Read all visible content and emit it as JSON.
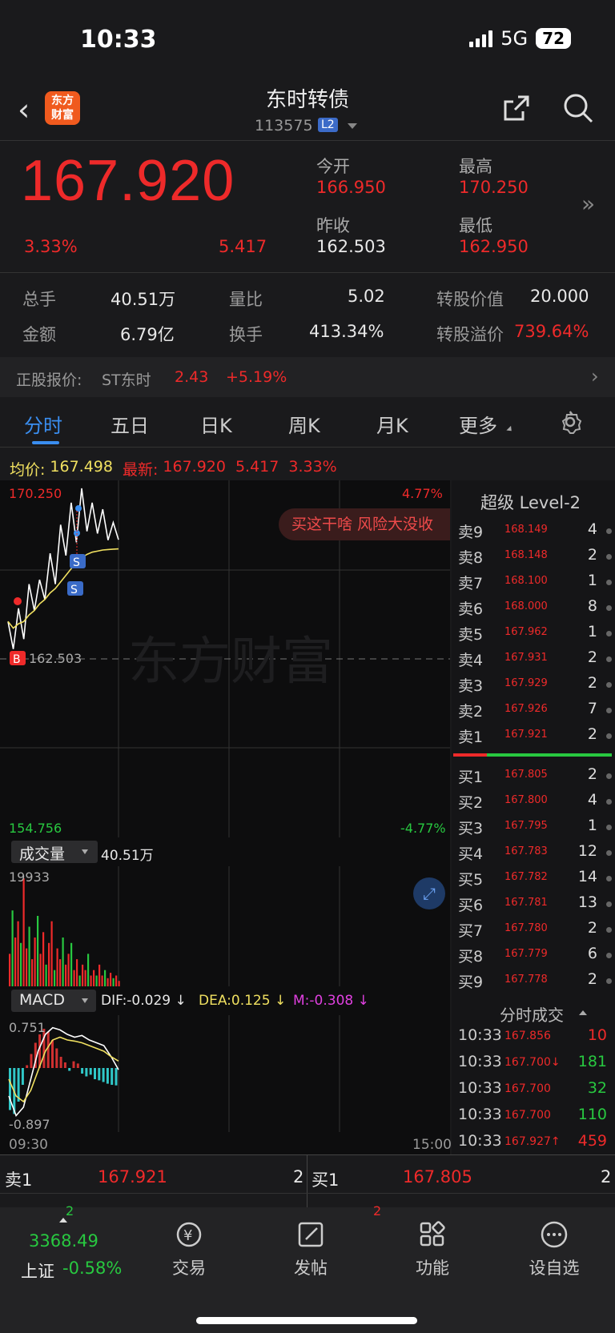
{
  "status_bar": {
    "time": "10:33",
    "network": "5G",
    "battery": "72"
  },
  "header": {
    "logo_text": "东方财富",
    "title": "东时转债",
    "code": "113575",
    "level_badge": "L2"
  },
  "quote": {
    "price": "167.920",
    "change_pct": "3.33%",
    "change": "5.417",
    "open_label": "今开",
    "open": "166.950",
    "prev_close_label": "昨收",
    "prev_close": "162.503",
    "high_label": "最高",
    "high": "170.250",
    "low_label": "最低",
    "low": "162.950"
  },
  "stats": {
    "volume_label": "总手",
    "volume": "40.51万",
    "amount_label": "金额",
    "amount": "6.79亿",
    "ratio_label": "量比",
    "ratio": "5.02",
    "turnover_label": "换手",
    "turnover": "413.34%",
    "conv_value_label": "转股价值",
    "conv_value": "20.000",
    "conv_premium_label": "转股溢价",
    "conv_premium": "739.64%"
  },
  "underlying": {
    "label": "正股报价:",
    "name": "ST东时",
    "price": "2.43",
    "change_pct": "+5.19%"
  },
  "tabs": [
    "分时",
    "五日",
    "日K",
    "周K",
    "月K",
    "更多"
  ],
  "chart_header": {
    "avg_label": "均价:",
    "avg": "167.498",
    "latest_label": "最新:",
    "latest": "167.920",
    "change": "5.417",
    "change_pct": "3.33%"
  },
  "chart": {
    "y_top": "170.250",
    "y_bottom": "154.756",
    "pct_top": "4.77%",
    "pct_bottom": "-4.77%",
    "mid_label": "162.503",
    "watermark": "东方财富",
    "banner": "买这干啥 风险大没收",
    "x_start": "09:30",
    "x_end": "15:00",
    "volume_label": "成交量",
    "volume_total": "40.51万",
    "volume_max": "19933",
    "macd_label": "MACD",
    "dif": "DIF:-0.029 ↓",
    "dea": "DEA:0.125 ↓",
    "m": "M:-0.308 ↓",
    "macd_top": "0.751",
    "macd_bottom": "-0.897"
  },
  "chart_data": {
    "type": "line",
    "series": [
      {
        "values": [
          164.2,
          162.95,
          164.8,
          163.4,
          165.9,
          164.7,
          166.1,
          165.2,
          167.3,
          165.9,
          168.6,
          167.2,
          169.6,
          167.8,
          170.25,
          168.3,
          169.6,
          168.2,
          169.3,
          167.9,
          168.7,
          167.92
        ]
      },
      {
        "values": [
          164.2,
          163.9,
          164.1,
          164.2,
          164.5,
          164.7,
          165.0,
          165.2,
          165.5,
          165.7,
          166.0,
          166.3,
          166.6,
          166.9,
          167.1,
          167.25,
          167.35,
          167.4,
          167.45,
          167.47,
          167.49,
          167.5
        ]
      }
    ],
    "ylim": [
      154.756,
      170.25
    ],
    "volume": [
      6000,
      14000,
      9000,
      12000,
      8000,
      19933,
      7000,
      11000,
      5000,
      9000,
      13000,
      6000,
      10000,
      4000,
      8000,
      12000,
      3000,
      7000,
      5000,
      9000,
      4000,
      6000,
      8000,
      3000,
      5000,
      2000,
      4000,
      3000,
      6000,
      2000,
      3000,
      2000,
      4000,
      2000,
      3000,
      1500,
      2500,
      1500,
      2000,
      1000
    ],
    "macd_bars": [
      -0.75,
      -0.82,
      -0.6,
      -0.3,
      0.05,
      0.25,
      0.45,
      0.6,
      0.7,
      0.65,
      0.5,
      0.35,
      0.2,
      0.1,
      -0.05,
      0.12,
      0.08,
      -0.1,
      -0.15,
      -0.12,
      -0.2,
      -0.22,
      -0.25,
      -0.28,
      -0.3,
      -0.31
    ],
    "dif": [
      -0.5,
      -0.85,
      -0.7,
      -0.2,
      0.3,
      0.6,
      0.72,
      0.68,
      0.6,
      0.55,
      0.58,
      0.5,
      0.45,
      0.4,
      0.2,
      -0.03
    ],
    "dea": [
      -0.2,
      -0.5,
      -0.6,
      -0.4,
      -0.05,
      0.3,
      0.5,
      0.55,
      0.5,
      0.48,
      0.45,
      0.4,
      0.35,
      0.3,
      0.2,
      0.125
    ]
  },
  "orderbook": {
    "title": "超级 Level-2",
    "asks": [
      {
        "label": "卖9",
        "price": "168.149",
        "vol": "4"
      },
      {
        "label": "卖8",
        "price": "168.148",
        "vol": "2"
      },
      {
        "label": "卖7",
        "price": "168.100",
        "vol": "1"
      },
      {
        "label": "卖6",
        "price": "168.000",
        "vol": "8"
      },
      {
        "label": "卖5",
        "price": "167.962",
        "vol": "1"
      },
      {
        "label": "卖4",
        "price": "167.931",
        "vol": "2"
      },
      {
        "label": "卖3",
        "price": "167.929",
        "vol": "2"
      },
      {
        "label": "卖2",
        "price": "167.926",
        "vol": "7"
      },
      {
        "label": "卖1",
        "price": "167.921",
        "vol": "2"
      }
    ],
    "bids": [
      {
        "label": "买1",
        "price": "167.805",
        "vol": "2"
      },
      {
        "label": "买2",
        "price": "167.800",
        "vol": "4"
      },
      {
        "label": "买3",
        "price": "167.795",
        "vol": "1"
      },
      {
        "label": "买4",
        "price": "167.783",
        "vol": "12"
      },
      {
        "label": "买5",
        "price": "167.782",
        "vol": "14"
      },
      {
        "label": "买6",
        "price": "167.781",
        "vol": "13"
      },
      {
        "label": "买7",
        "price": "167.780",
        "vol": "2"
      },
      {
        "label": "买8",
        "price": "167.779",
        "vol": "6"
      },
      {
        "label": "买9",
        "price": "167.778",
        "vol": "2"
      }
    ],
    "trades_title": "分时成交",
    "trades": [
      {
        "time": "10:33",
        "price": "167.856",
        "vol": "10",
        "color": "#ee2a2a"
      },
      {
        "time": "10:33",
        "price": "167.700↓",
        "vol": "181",
        "color": "#28c840"
      },
      {
        "time": "10:33",
        "price": "167.700",
        "vol": "32",
        "color": "#28c840"
      },
      {
        "time": "10:33",
        "price": "167.700",
        "vol": "110",
        "color": "#28c840"
      },
      {
        "time": "10:33",
        "price": "167.927↑",
        "vol": "459",
        "color": "#ee2a2a"
      }
    ]
  },
  "best": {
    "ask_label": "卖1",
    "ask_price": "167.921",
    "ask_vol": "2",
    "bid_label": "买1",
    "bid_price": "167.805",
    "bid_vol": "2",
    "ask_sub": "2",
    "bid_sub": "2"
  },
  "bottom_nav": {
    "index_value": "3368.49",
    "index_name": "上证",
    "index_change": "-0.58%",
    "items": [
      "交易",
      "发帖",
      "功能",
      "设自选"
    ]
  },
  "colors": {
    "up": "#ee2a2a",
    "down": "#28c840",
    "accent": "#3a8ef0",
    "avg_line": "#f0e060"
  }
}
